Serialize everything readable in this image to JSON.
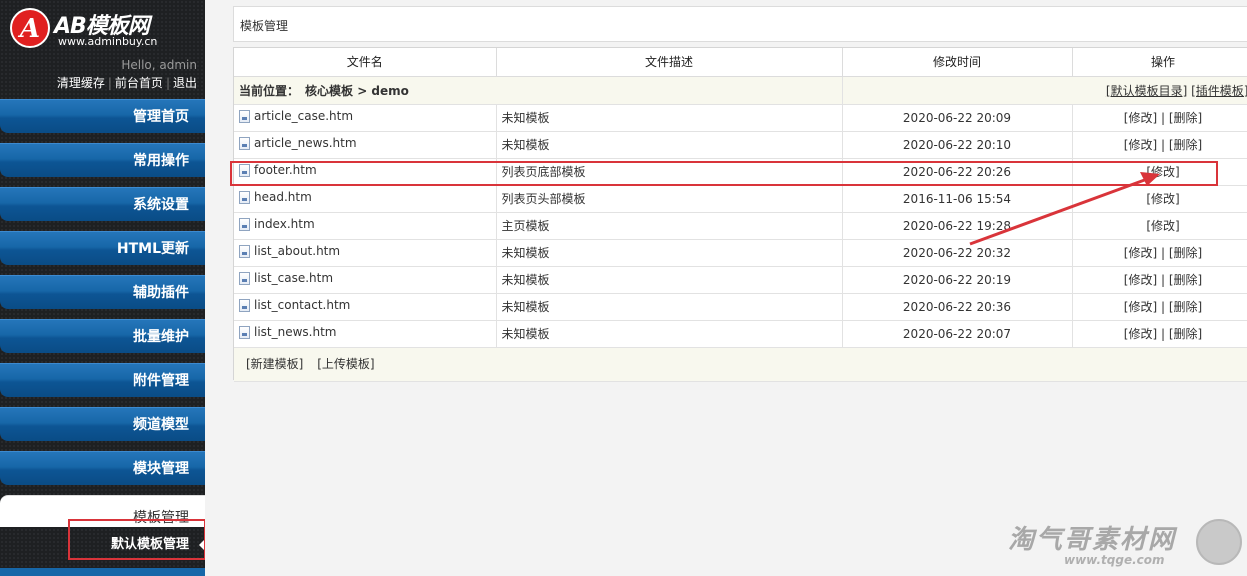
{
  "logo": {
    "emblem": "A",
    "name": "AB模板网",
    "url": "www.adminbuy.cn"
  },
  "user": {
    "greeting": "Hello, admin",
    "links": [
      "清理缓存",
      "前台首页",
      "退出"
    ]
  },
  "sidebar": {
    "items": [
      "管理首页",
      "常用操作",
      "系统设置",
      "HTML更新",
      "辅助插件",
      "批量维护",
      "附件管理",
      "频道模型",
      "模块管理",
      "模板管理"
    ],
    "active": "模板管理",
    "submenu": "默认模板管理"
  },
  "page_title": "模板管理",
  "table": {
    "headers": [
      "文件名",
      "文件描述",
      "修改时间",
      "操作"
    ],
    "crumb": {
      "label": "当前位置：",
      "path": "核心模板 > demo",
      "links": [
        "[默认模板目录]",
        "[插件模板]"
      ]
    },
    "rows": [
      {
        "file": "article_case.htm",
        "desc": "未知模板",
        "time": "2020-06-22 20:09",
        "ops": "[修改] | [删除]"
      },
      {
        "file": "article_news.htm",
        "desc": "未知模板",
        "time": "2020-06-22 20:10",
        "ops": "[修改] | [删除]"
      },
      {
        "file": "footer.htm",
        "desc": "列表页底部模板",
        "time": "2020-06-22 20:26",
        "ops": "[修改]"
      },
      {
        "file": "head.htm",
        "desc": "列表页头部模板",
        "time": "2016-11-06 15:54",
        "ops": "[修改]"
      },
      {
        "file": "index.htm",
        "desc": "主页模板",
        "time": "2020-06-22 19:28",
        "ops": "[修改]"
      },
      {
        "file": "list_about.htm",
        "desc": "未知模板",
        "time": "2020-06-22 20:32",
        "ops": "[修改] | [删除]"
      },
      {
        "file": "list_case.htm",
        "desc": "未知模板",
        "time": "2020-06-22 20:19",
        "ops": "[修改] | [删除]"
      },
      {
        "file": "list_contact.htm",
        "desc": "未知模板",
        "time": "2020-06-22 20:36",
        "ops": "[修改] | [删除]"
      },
      {
        "file": "list_news.htm",
        "desc": "未知模板",
        "time": "2020-06-22 20:07",
        "ops": "[修改] | [删除]"
      }
    ],
    "bottom_actions": [
      "[新建模板]",
      "[上传模板]"
    ]
  },
  "watermark": {
    "title": "淘气哥素材网",
    "url": "www.tqge.com"
  },
  "colors": {
    "menu_blue": "#1767a8",
    "highlight_red": "#d9343a",
    "sidebar_dark": "#1e2022"
  }
}
